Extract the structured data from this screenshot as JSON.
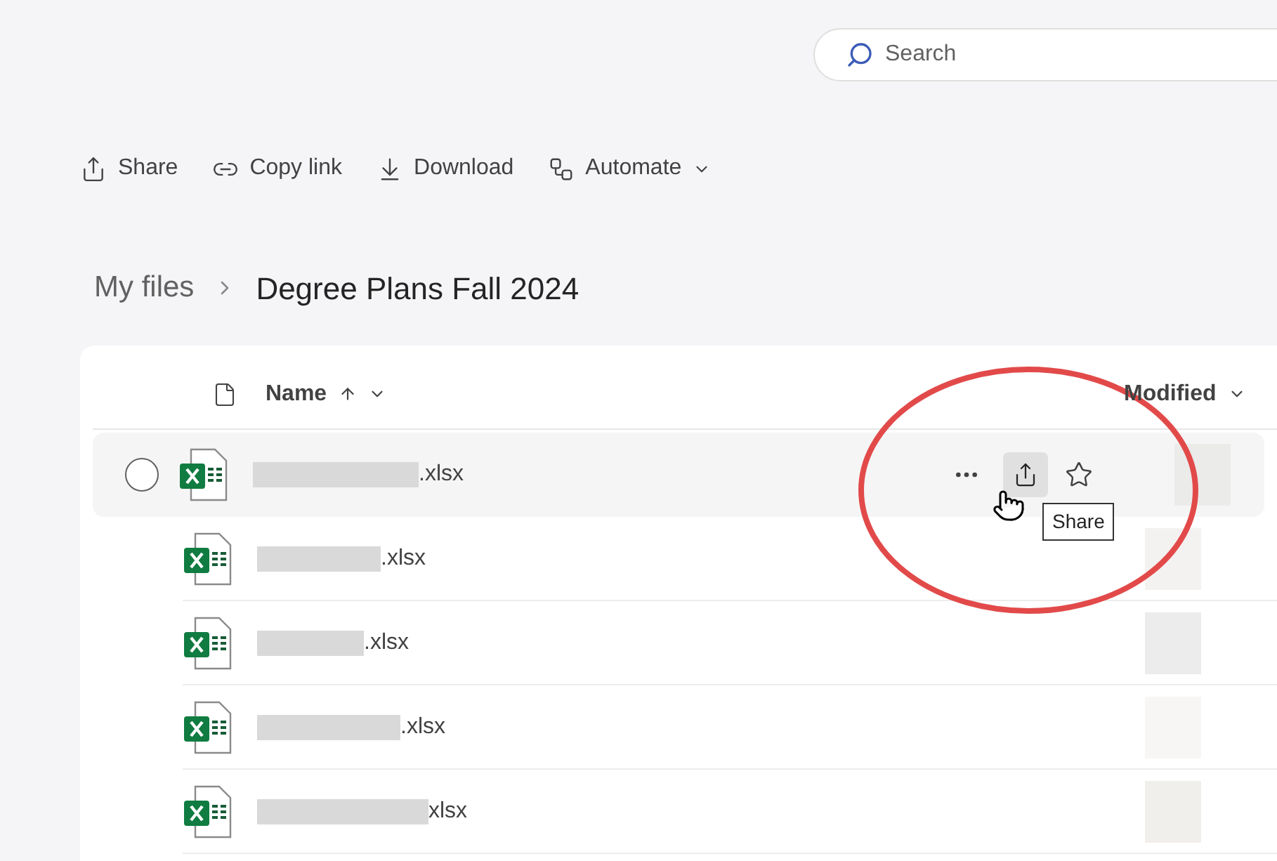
{
  "search": {
    "placeholder": "Search"
  },
  "toolbar": [
    {
      "kind": "share",
      "label": "Share"
    },
    {
      "kind": "link",
      "label": "Copy link"
    },
    {
      "kind": "download",
      "label": "Download"
    },
    {
      "kind": "automate",
      "label": "Automate",
      "menu": true
    }
  ],
  "breadcrumb": [
    {
      "label": "My files",
      "current": false
    },
    {
      "label": "Degree Plans Fall 2024",
      "current": true
    }
  ],
  "table": {
    "columns": [
      {
        "kind": "type"
      },
      {
        "kind": "name",
        "label": "Name",
        "sorted_ascending": true
      },
      {
        "kind": "modified",
        "label": "Modified"
      }
    ],
    "rows": [
      {
        "name": ".xlsx",
        "hovered": true,
        "tooltip": "Share"
      },
      {
        "name": ".xlsx",
        "hovered": false
      },
      {
        "name": ".xlsx",
        "hovered": false
      },
      {
        "name": ".xlsx",
        "hovered": false
      },
      {
        "name": "xlsx",
        "hovered": false
      }
    ]
  }
}
